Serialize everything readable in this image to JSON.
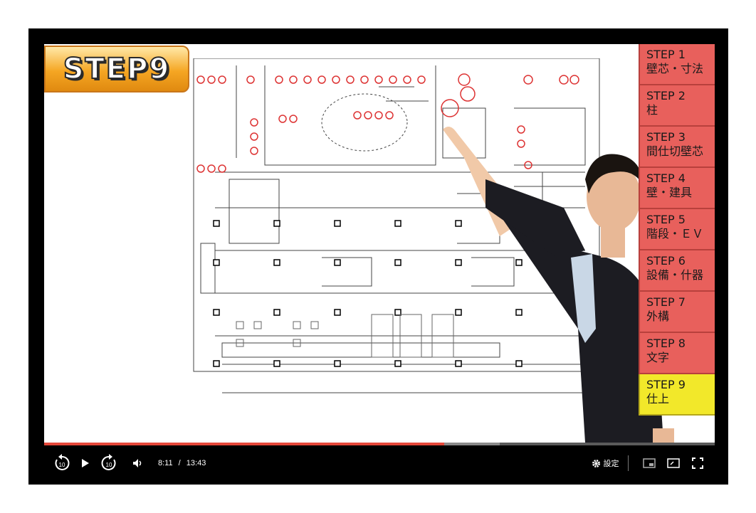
{
  "video": {
    "step_badge": "STEP9",
    "steps": [
      {
        "title": "STEP 1",
        "subtitle": "壁芯・寸法",
        "active": false
      },
      {
        "title": "STEP 2",
        "subtitle": "柱",
        "active": false
      },
      {
        "title": "STEP 3",
        "subtitle": "間仕切壁芯",
        "active": false
      },
      {
        "title": "STEP 4",
        "subtitle": "壁・建具",
        "active": false
      },
      {
        "title": "STEP 5",
        "subtitle": "階段・ＥＶ",
        "active": false
      },
      {
        "title": "STEP 6",
        "subtitle": "設備・什器",
        "active": false
      },
      {
        "title": "STEP 7",
        "subtitle": "外構",
        "active": false
      },
      {
        "title": "STEP 8",
        "subtitle": "文字",
        "active": false
      },
      {
        "title": "STEP 9",
        "subtitle": "仕上",
        "active": true
      }
    ]
  },
  "player": {
    "current_time": "8:11",
    "separator": "/",
    "duration": "13:43",
    "progress_fraction": 0.597,
    "rewind_label": "10",
    "forward_label": "10",
    "settings_label": "設定",
    "colors": {
      "progress": "#e5483a",
      "background": "#000000"
    },
    "icons": [
      "rewind-10-icon",
      "play-icon",
      "forward-10-icon",
      "volume-icon",
      "gear-icon",
      "miniplayer-icon",
      "theater-mode-icon",
      "fullscreen-icon"
    ]
  }
}
